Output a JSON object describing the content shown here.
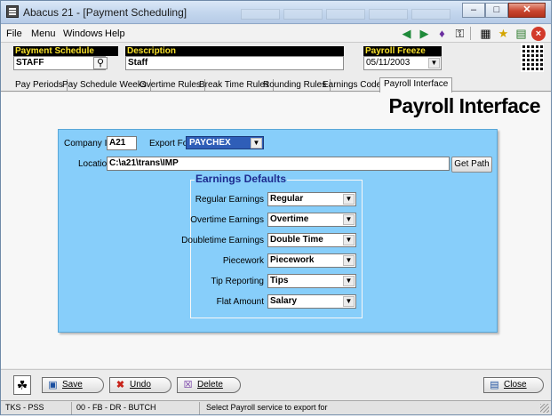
{
  "window": {
    "title": "Abacus 21 - [Payment Scheduling]"
  },
  "menu": [
    "File",
    "Menu",
    "Windows",
    "Help"
  ],
  "header": {
    "code_label": "Payment Schedule Code",
    "code_value": "STAFF",
    "desc_label": "Description",
    "desc_value": "Staff",
    "freeze_label": "Payroll Freeze Date",
    "freeze_value": "05/11/2003"
  },
  "tabs": [
    "Pay Periods",
    "Pay Schedule Weeks",
    "Overtime Rules",
    "Break Time Rules",
    "Rounding Rules",
    "Earnings Codes",
    "Payroll Interface"
  ],
  "active_tab": "Payroll Interface",
  "page_heading": "Payroll Interface",
  "form": {
    "company_id_label": "Company ID",
    "company_id_value": "A21",
    "export_for_label": "Export For",
    "export_for_value": "PAYCHEX",
    "location_label": "Location",
    "location_value": "C:\\a21\\trans\\IMP",
    "get_path_label": "Get Path"
  },
  "earnings": {
    "title": "Earnings Defaults",
    "rows": [
      {
        "label": "Regular Earnings",
        "value": "Regular"
      },
      {
        "label": "Overtime Earnings",
        "value": "Overtime"
      },
      {
        "label": "Doubletime Earnings",
        "value": "Double Time"
      },
      {
        "label": "Piecework",
        "value": "Piecework"
      },
      {
        "label": "Tip Reporting",
        "value": "Tips"
      },
      {
        "label": "Flat Amount",
        "value": "Salary"
      }
    ]
  },
  "footer": {
    "save": "Save",
    "undo": "Undo",
    "delete": "Delete",
    "close": "Close"
  },
  "status": {
    "app": "TKS - PSS",
    "user": "00 - FB - DR - BUTCH",
    "message": "Select Payroll service to export for"
  },
  "colors": {
    "panel": "#87cefa",
    "label_text": "#f7e02a",
    "group_title": "#1d2b8f",
    "close_button": "#c9462f"
  }
}
